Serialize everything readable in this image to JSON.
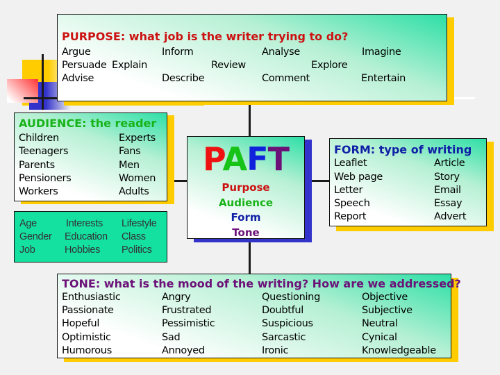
{
  "colors": {
    "purpose": "#cc1111",
    "audience": "#18b318",
    "form": "#0f1fa6",
    "tone": "#6b1177",
    "box_gradient": "#2ddfa6",
    "shadow_yellow": "#ffcc00",
    "shadow_blue": "#3333cc",
    "teal_box": "#14e0a0"
  },
  "purpose": {
    "title": "PURPOSE: what job is the writer trying to do?",
    "words": [
      "Argue",
      "Persuade",
      "Explain",
      "Advise",
      "Inform",
      "Describe",
      "Review",
      "Analyse",
      "Comment",
      "Explore",
      "Imagine",
      "Entertain"
    ]
  },
  "audience": {
    "title": "AUDIENCE: the reader",
    "col1": [
      "Children",
      "Teenagers",
      "Parents",
      "Pensioners",
      "Workers"
    ],
    "col2": [
      "Experts",
      "Fans",
      "Men",
      "Women",
      "Adults"
    ]
  },
  "factors": {
    "col1": [
      "Age",
      "Gender",
      "Job"
    ],
    "col2": [
      "Interests",
      "Education",
      "Hobbies"
    ],
    "col3": [
      "Lifestyle",
      "Class",
      "Politics"
    ]
  },
  "paft": {
    "letters": [
      "P",
      "A",
      "F",
      "T"
    ],
    "words": [
      "Purpose",
      "Audience",
      "Form",
      "Tone"
    ]
  },
  "form": {
    "title": "FORM: type of writing",
    "col1": [
      "Leaflet",
      "Web page",
      "Letter",
      "Speech",
      "Report"
    ],
    "col2": [
      "Article",
      "Story",
      "Email",
      "Essay",
      "Advert"
    ]
  },
  "tone": {
    "title": "TONE: what is the mood of the writing?  How are we addressed?",
    "col1": [
      "Enthusiastic",
      "Passionate",
      "Hopeful",
      "Optimistic",
      "Humorous"
    ],
    "col2": [
      "Angry",
      "Frustrated",
      "Pessimistic",
      "Sad",
      "Annoyed"
    ],
    "col3": [
      "Questioning",
      "Doubtful",
      "Suspicious",
      "Sarcastic",
      "Ironic"
    ],
    "col4": [
      "Objective",
      "Subjective",
      "Neutral",
      "Cynical",
      "Knowledgeable"
    ]
  }
}
